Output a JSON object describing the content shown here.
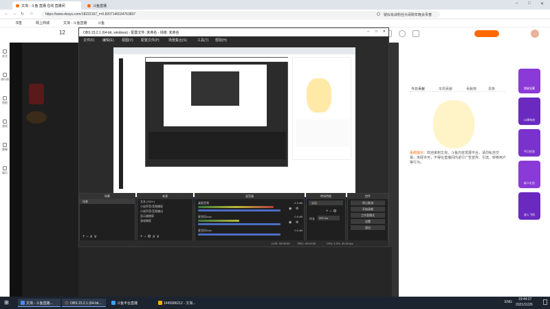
{
  "browser": {
    "tabs": [
      {
        "label": "文淘 - 斗鱼 直播 在线 直播间",
        "active": true
      },
      {
        "label": "斗鱼直播",
        "active": false
      }
    ],
    "url": "https://www.douyu.com/18222167_r=0.8207146034763837",
    "search_text": "疑似肖战粉丝大闹跨年晚会青春",
    "bookmarks": [
      "书签",
      "网上商城",
      "文淘 - 斗鱼直播",
      "斗鱼"
    ],
    "window_controls": [
      "minimize",
      "maximize",
      "close"
    ]
  },
  "left_nav": [
    "关注",
    "排行榜",
    "鱼吧",
    "游戏",
    "赛事",
    "娱乐"
  ],
  "room": {
    "number": "12"
  },
  "obs": {
    "title": "OBS 23.2.1 (64-bit, windows) - 配置文件: 未命名 - 场景: 未命名",
    "menu": [
      "文件(F)",
      "编辑(E)",
      "视图(V)",
      "配置文件(P)",
      "场景集合(S)",
      "工具(T)",
      "帮助(H)"
    ],
    "docks": {
      "scenes": {
        "title": "场景",
        "items": [
          "场景"
        ]
      },
      "sources": {
        "title": "来源",
        "items": [
          "文本 (GDI+)",
          "小说声音/音频捕捉",
          "小说声音/音频输出",
          "显示器捕获",
          "游戏捕获"
        ]
      },
      "mixer": {
        "title": "混音器",
        "channels": [
          {
            "name": "桌面音频",
            "level": "-1.9 dB"
          },
          {
            "name": "麦克风/Aux",
            "level": "0.0 dB"
          },
          {
            "name": "麦克风/Aux",
            "level": "0.0 dB"
          }
        ]
      },
      "transitions": {
        "title": "转场特效",
        "type": "淡出",
        "duration_label": "时长",
        "duration": "300 ms"
      },
      "controls": {
        "title": "控件",
        "buttons": [
          "停止推流",
          "开始录制",
          "工作室模式",
          "设置",
          "退出"
        ]
      }
    },
    "status": {
      "live": "LIVE: 00:00:00",
      "rec": "REC: 00:00:00",
      "cpu": "CPU: 1.0%, 30.00 fps"
    }
  },
  "chat": {
    "tabs": [
      "今日贡献",
      "本周贡献",
      "贡献榜",
      "贵族"
    ],
    "notice_title": "系统提示",
    "notice": "欢迎来到文淘，斗鱼内容发展平台，请勿私自交易，未经许可，不得在直播间内进行广告宣传、引流、转移用户等行为。"
  },
  "side_ads": [
    "超级宝藏",
    "12周年庆",
    "今日任务",
    "新人礼包",
    "送入飞机"
  ],
  "taskbar": {
    "items": [
      {
        "label": "文淘 - 斗鱼直播...",
        "active": true
      },
      {
        "label": "OBS 23.2.1 (64-bit...",
        "active": true
      },
      {
        "label": "斗鱼平台直播",
        "active": false
      },
      {
        "label": "1445996212 - 文淘...",
        "active": false
      }
    ],
    "lang": "ENG",
    "time": "19:44:27",
    "date": "2021/11/26"
  },
  "colors": {
    "accent": "#ff6a00",
    "obs_bg": "#2b2b2b",
    "taskbar": "#1c2430",
    "side_ad": "#8a3ad6"
  }
}
